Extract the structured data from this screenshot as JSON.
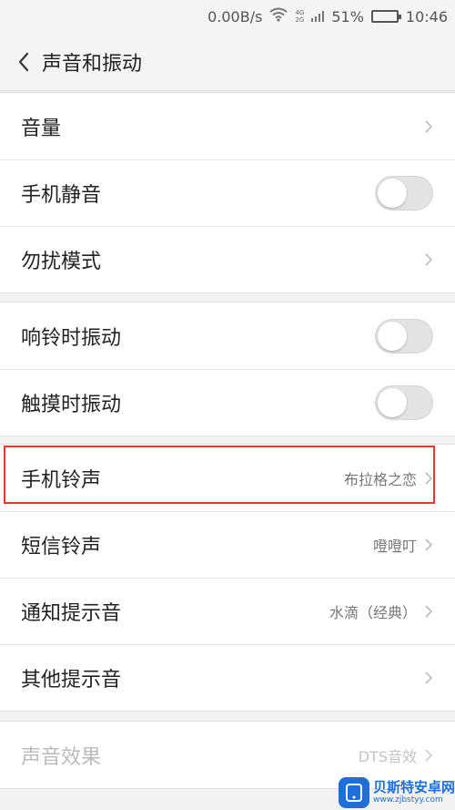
{
  "status_bar": {
    "net_speed": "0.00B/s",
    "net_4g": "4G",
    "net_2g": "2G",
    "battery_text": "51%",
    "battery_level": 0.51,
    "time": "10:46"
  },
  "header": {
    "title": "声音和振动"
  },
  "groups": [
    {
      "rows": [
        {
          "label": "音量",
          "type": "chevron"
        },
        {
          "label": "手机静音",
          "type": "toggle",
          "on": false
        },
        {
          "label": "勿扰模式",
          "type": "chevron"
        }
      ]
    },
    {
      "rows": [
        {
          "label": "响铃时振动",
          "type": "toggle",
          "on": false
        },
        {
          "label": "触摸时振动",
          "type": "toggle",
          "on": false
        }
      ]
    },
    {
      "rows": [
        {
          "label": "手机铃声",
          "value": "布拉格之恋",
          "type": "chevron"
        },
        {
          "label": "短信铃声",
          "value": "噔噔叮",
          "type": "chevron"
        },
        {
          "label": "通知提示音",
          "value": "水滴（经典）",
          "type": "chevron"
        },
        {
          "label": "其他提示音",
          "type": "chevron"
        }
      ]
    },
    {
      "rows": [
        {
          "label": "声音效果",
          "value": "DTS音效",
          "type": "chevron",
          "disabled": true
        }
      ]
    }
  ],
  "watermark": {
    "title": "贝斯特安卓网",
    "url": "www.zjbstyy.com"
  },
  "colors": {
    "highlight": "#e0392f",
    "brand": "#1e6fd9"
  }
}
